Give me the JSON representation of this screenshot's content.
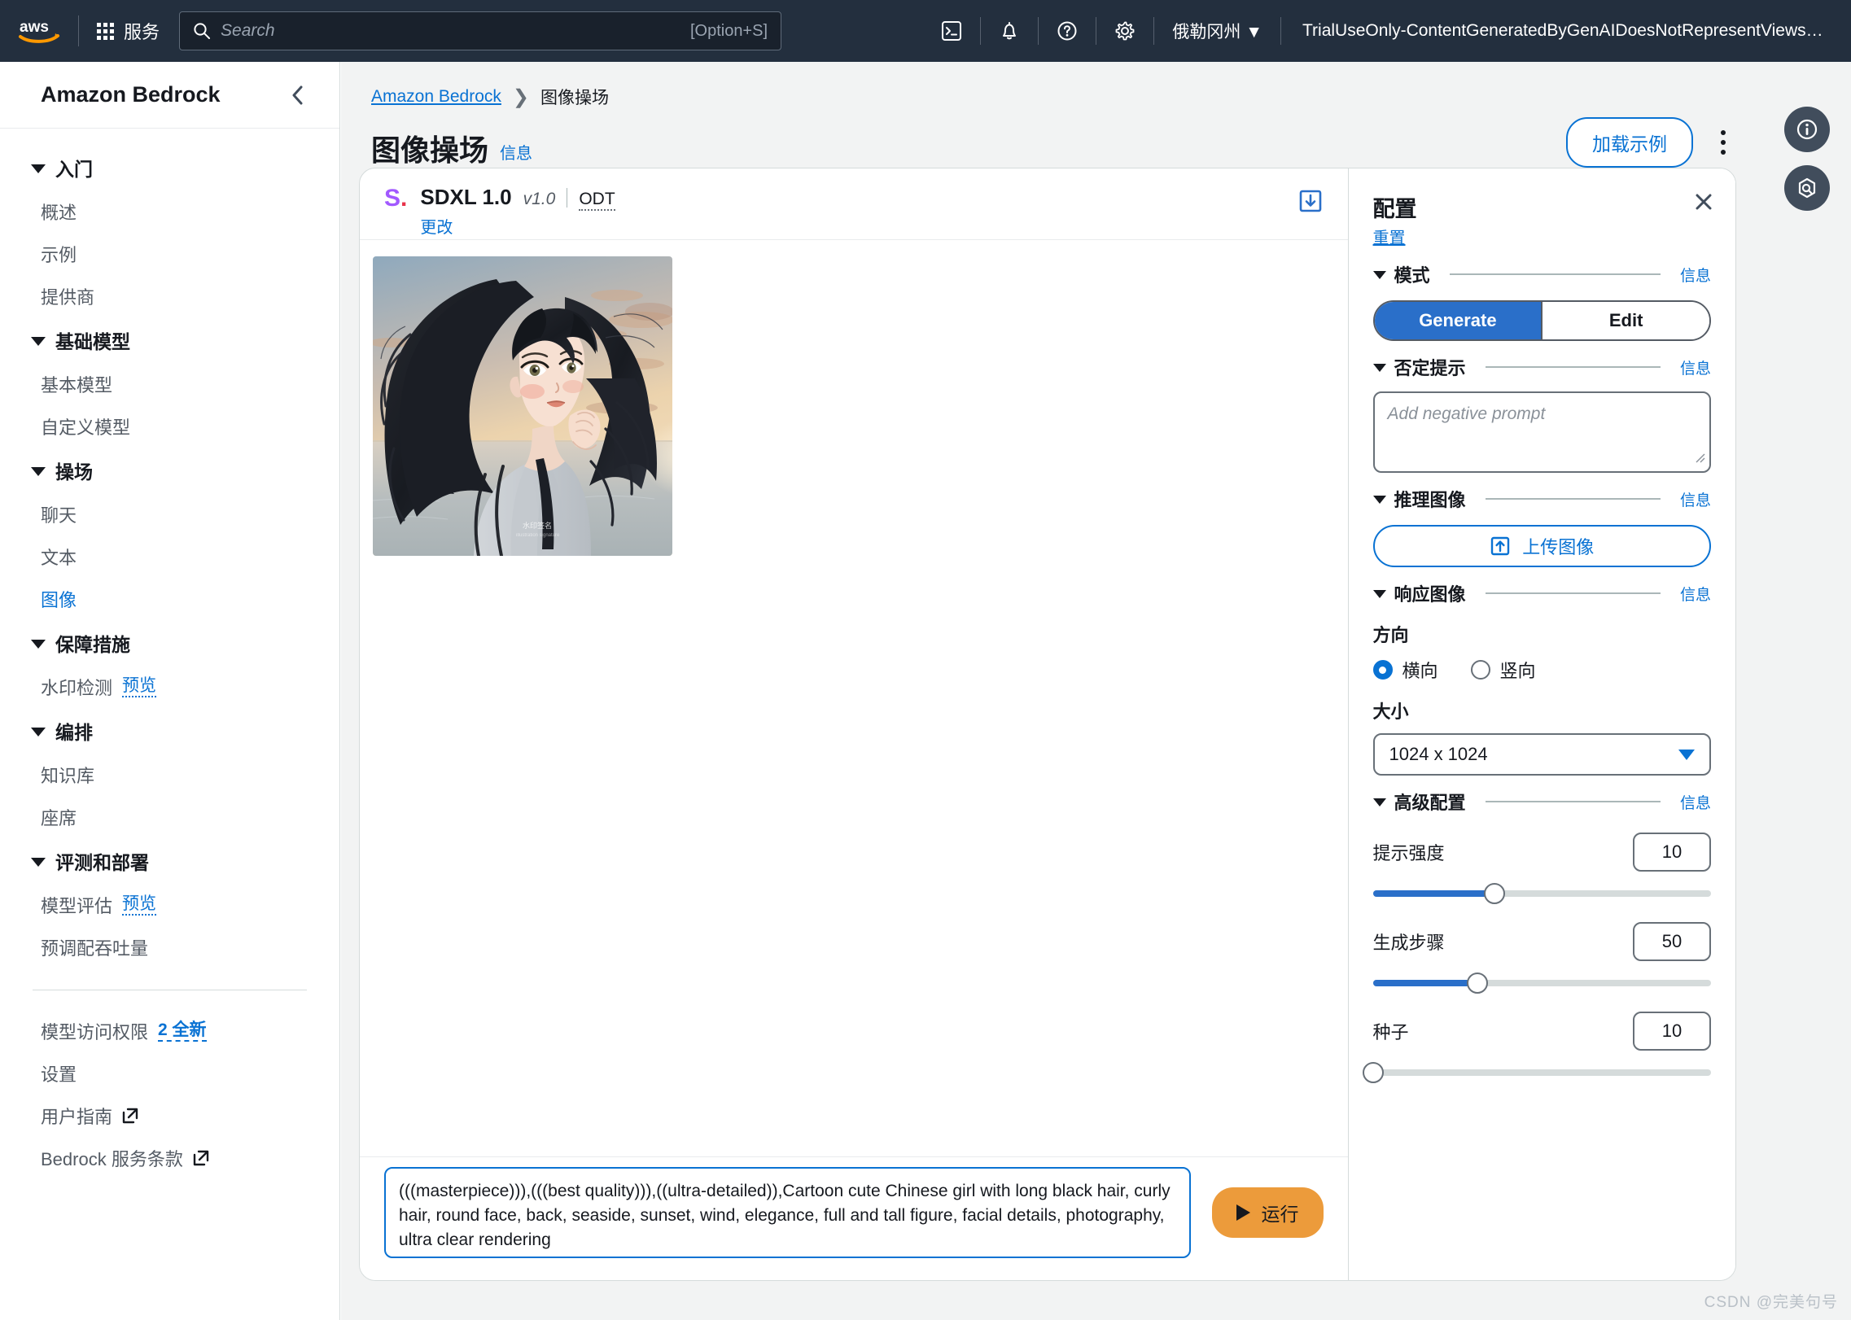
{
  "topnav": {
    "logo": "aws-logo",
    "services_label": "服务",
    "search_placeholder": "Search",
    "search_shortcut": "[Option+S]",
    "icons": [
      "cloudshell-icon",
      "notifications-bell-icon",
      "help-circle-icon",
      "settings-gear-icon"
    ],
    "region": "俄勒冈州",
    "account": "TrialUseOnly-ContentGeneratedByGenAIDoesNotRepresentViewsOfAW..."
  },
  "sidebar": {
    "title": "Amazon Bedrock",
    "groups": [
      {
        "label": "入门",
        "items": [
          {
            "label": "概述"
          },
          {
            "label": "示例"
          },
          {
            "label": "提供商"
          }
        ]
      },
      {
        "label": "基础模型",
        "items": [
          {
            "label": "基本模型"
          },
          {
            "label": "自定义模型"
          }
        ]
      },
      {
        "label": "操场",
        "items": [
          {
            "label": "聊天"
          },
          {
            "label": "文本"
          },
          {
            "label": "图像",
            "active": true
          }
        ]
      },
      {
        "label": "保障措施",
        "items": [
          {
            "label": "水印检测",
            "badge": "预览"
          }
        ]
      },
      {
        "label": "编排",
        "items": [
          {
            "label": "知识库"
          },
          {
            "label": "座席"
          }
        ]
      },
      {
        "label": "评测和部署",
        "items": [
          {
            "label": "模型评估",
            "badge": "预览"
          },
          {
            "label": "预调配吞吐量"
          }
        ]
      }
    ],
    "footer_items": [
      {
        "label": "模型访问权限",
        "badge_new": "2 全新"
      },
      {
        "label": "设置"
      },
      {
        "label": "用户指南",
        "external": true
      },
      {
        "label": "Bedrock 服务条款",
        "external": true
      }
    ]
  },
  "breadcrumb": {
    "root": "Amazon Bedrock",
    "current": "图像操场"
  },
  "page": {
    "title": "图像操场",
    "info_label": "信息",
    "load_example_label": "加载示例",
    "kebab_label": "more-options"
  },
  "model": {
    "logo_text": "S",
    "name": "SDXL 1.0",
    "version": "v1.0",
    "odt": "ODT",
    "change_label": "更改",
    "download_label": "download-image"
  },
  "prompt": {
    "text": "(((masterpiece))),(((best quality))),((ultra-detailed)),Cartoon cute Chinese girl with long black hair, curly hair, round face, back, seaside, sunset, wind, elegance, full and tall figure, facial details, photography, ultra clear rendering",
    "run_label": "运行"
  },
  "config": {
    "title": "配置",
    "reset_label": "重置",
    "info_label": "信息",
    "mode": {
      "label": "模式",
      "options": [
        "Generate",
        "Edit"
      ],
      "selected": "Generate"
    },
    "negative_prompt": {
      "label": "否定提示",
      "placeholder": "Add negative prompt",
      "value": ""
    },
    "inference_image": {
      "label": "推理图像",
      "upload_label": "上传图像"
    },
    "response_image": {
      "label": "响应图像",
      "orientation_label": "方向",
      "orientation_options": [
        "横向",
        "竖向"
      ],
      "orientation_selected": "横向",
      "size_label": "大小",
      "size_value": "1024 x 1024"
    },
    "advanced": {
      "label": "高级配置",
      "params": [
        {
          "name": "提示强度",
          "value": "10",
          "percent": 36
        },
        {
          "name": "生成步骤",
          "value": "50",
          "percent": 31
        },
        {
          "name": "种子",
          "value": "10",
          "percent": 0
        }
      ]
    }
  },
  "generated_image": {
    "alt": "cartoon-chinese-girl-seaside-sunset",
    "colors": {
      "sky_top": "#8fa9bd",
      "sky_mid": "#e7c9a4",
      "sun_glow": "#f6e3c3",
      "sea": "#b9bfc0",
      "hair": "#1d2026",
      "skin": "#f6ded0",
      "robe": "#c9cdd2"
    }
  },
  "watermark": "CSDN @完美句号"
}
